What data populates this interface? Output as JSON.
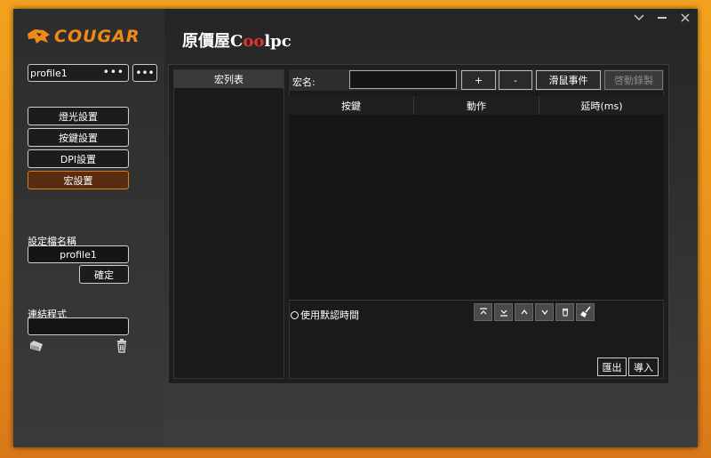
{
  "brand": {
    "logo_text": "COUGAR",
    "partner_pre": "原價屋",
    "partner_c": "C",
    "partner_oo": "oo",
    "partner_post": "lpc"
  },
  "window": {
    "minimize_icon": "chevron-down-icon",
    "restore_icon": "minus-icon",
    "close_icon": "close-icon"
  },
  "sidebar": {
    "profile_value": "profile1",
    "profile_dots": "•••",
    "more_dots": "•••",
    "items": [
      {
        "label": "燈光設置",
        "active": false
      },
      {
        "label": "按鍵設置",
        "active": false
      },
      {
        "label": "DPI設置",
        "active": false
      },
      {
        "label": "宏設置",
        "active": true
      }
    ],
    "profile_name_label": "設定檔名稱",
    "profile_name_value": "profile1",
    "confirm_label": "確定",
    "link_program_label": "連結程式"
  },
  "macro": {
    "list_header": "宏列表",
    "name_label": "宏名:",
    "add_label": "+",
    "remove_label": "-",
    "mouse_event_label": "滑鼠事件",
    "record_label": "啓動錄製",
    "columns": [
      "按鍵",
      "動作",
      "延時(ms)"
    ],
    "default_time_label": "使用默認時間",
    "export_label": "匯出",
    "import_label": "導入"
  }
}
